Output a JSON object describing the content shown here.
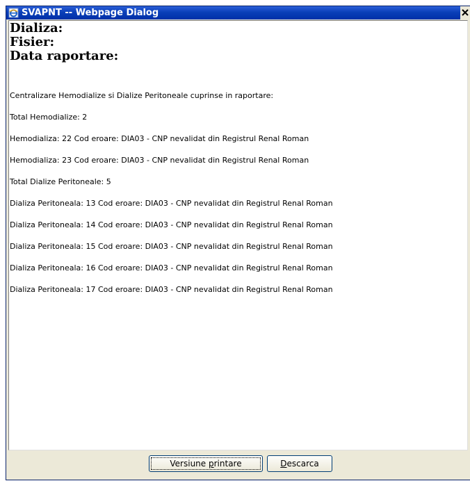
{
  "window": {
    "title": "SVAPNT -- Webpage Dialog",
    "close_label": "X"
  },
  "header": {
    "dializa": "Dializa:",
    "fisier": "Fisier:",
    "data_raportare": "Data raportare:"
  },
  "report": {
    "intro": "Centralizare Hemodialize si Dialize Peritoneale cuprinse in raportare:",
    "total_hemodialize": "Total Hemodialize: 2",
    "hemodialize": [
      "Hemodializa: 22 Cod eroare: DIA03 - CNP nevalidat din Registrul Renal Roman",
      "Hemodializa: 23 Cod eroare: DIA03 - CNP nevalidat din Registrul Renal Roman"
    ],
    "total_peritoneale": "Total Dialize Peritoneale: 5",
    "peritoneale": [
      "Dializa Peritoneala: 13 Cod eroare: DIA03 - CNP nevalidat din Registrul Renal Roman",
      "Dializa Peritoneala: 14 Cod eroare: DIA03 - CNP nevalidat din Registrul Renal Roman",
      "Dializa Peritoneala: 15 Cod eroare: DIA03 - CNP nevalidat din Registrul Renal Roman",
      "Dializa Peritoneala: 16 Cod eroare: DIA03 - CNP nevalidat din Registrul Renal Roman",
      "Dializa Peritoneala: 17 Cod eroare: DIA03 - CNP nevalidat din Registrul Renal Roman"
    ]
  },
  "buttons": {
    "print_pre": "Versiune ",
    "print_mnemonic": "p",
    "print_post": "rintare",
    "download_mnemonic": "D",
    "download_post": "escarca"
  },
  "icons": {
    "title_icon": "ie-page-icon",
    "close_icon": "close-icon"
  }
}
